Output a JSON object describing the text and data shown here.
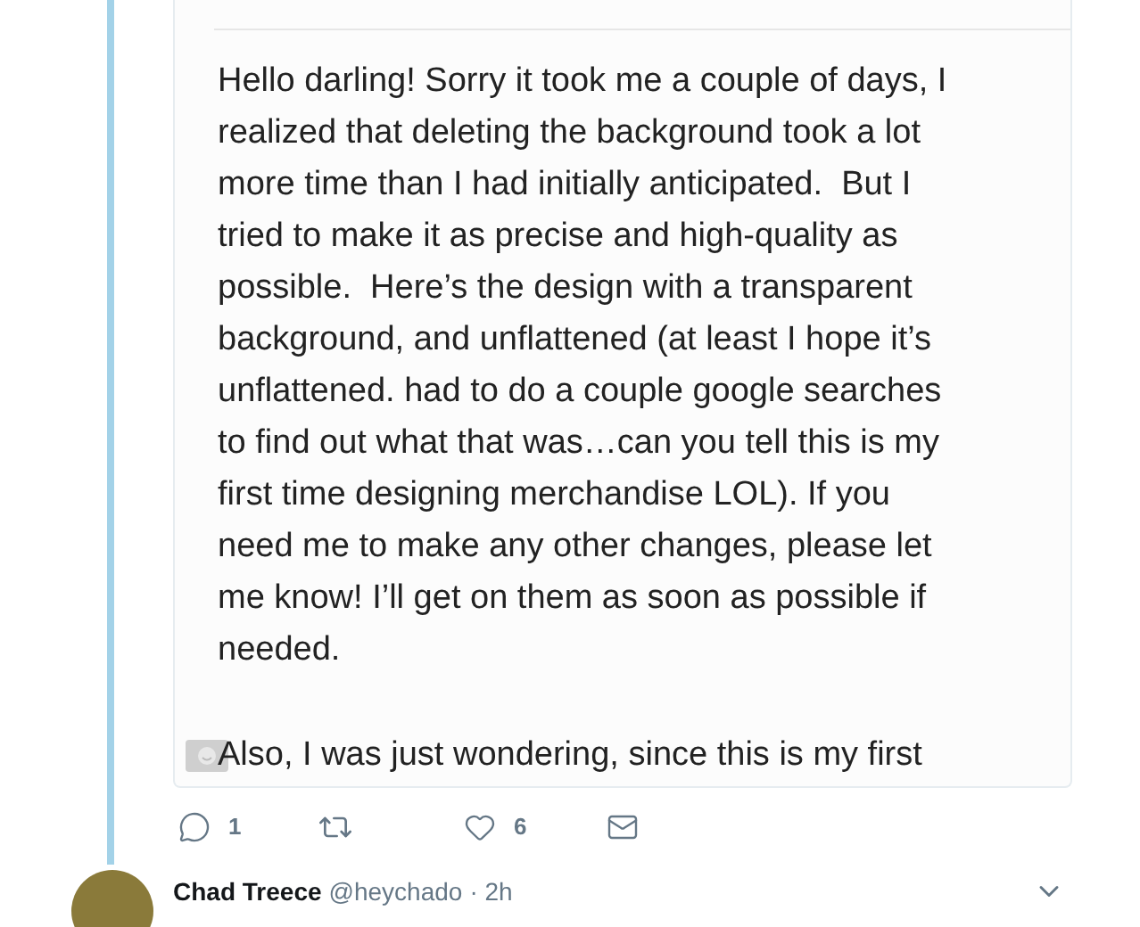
{
  "tweet": {
    "image": {
      "lines": [
        "Hello darling! Sorry it took me a couple of days, I",
        "realized that deleting the background took a lot",
        "more time than I had initially anticipated.  But I",
        "tried to make it as precise and high-quality as",
        "possible.  Here’s the design with a transparent",
        "background, and unflattened (at least I hope it’s",
        "unflattened. had to do a couple google searches",
        "to find out what that was…can you tell this is my",
        "first time designing merchandise LOL). If you",
        "need me to make any other changes, please let",
        "me know! I’ll get on them as soon as possible if",
        "needed."
      ],
      "second_paragraph": "Also, I was just wondering, since this is my first"
    },
    "actions": {
      "replies": "1",
      "likes": "6"
    }
  },
  "reply": {
    "name": "Chad Treece",
    "handle": "@heychado",
    "time": "· 2h"
  }
}
